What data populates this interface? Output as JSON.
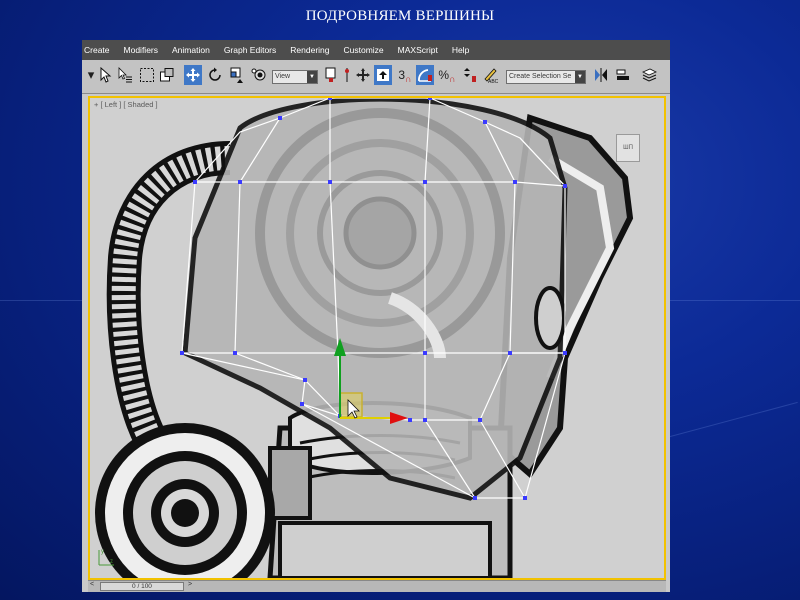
{
  "slide": {
    "title": "ПОДРОВНЯЕМ ВЕРШИНЫ"
  },
  "app": {
    "menu": [
      "Create",
      "Modifiers",
      "Animation",
      "Graph Editors",
      "Rendering",
      "Customize",
      "MAXScript",
      "Help"
    ],
    "toolbar": {
      "reference_coord": "View",
      "named_selection_placeholder": "Create Selection Se",
      "snap_value": "3",
      "icons": [
        "select-filter-icon",
        "select-object-icon",
        "select-by-name-icon",
        "rect-selection-icon",
        "window-crossing-icon",
        "select-move-icon",
        "select-rotate-icon",
        "select-scale-icon",
        "pivot-icon",
        "select-link-icon",
        "move-icon",
        "snap-toggle-icon",
        "angle-snap-icon",
        "percent-snap-icon",
        "spinner-snap-icon",
        "edit-named-selection-icon",
        "mirror-icon",
        "align-icon",
        "layer-manager-icon"
      ],
      "active_icons": [
        "select-move-icon",
        "angle-snap-icon"
      ]
    },
    "viewport": {
      "label": "+ [ Left ] [ Shaded ]",
      "gizmo_label": "ШП"
    },
    "timeline": {
      "frame": "0 / 100",
      "prev": "<",
      "next": ">"
    },
    "colors": {
      "menubar": "#4d4d4d",
      "toolbar": "#c3c3c3",
      "viewport_border": "#f2c200",
      "vertex": "#3a3aff",
      "gizmo_x": "#e01010",
      "gizmo_y": "#10a020",
      "active_button": "#3f78c7"
    }
  }
}
